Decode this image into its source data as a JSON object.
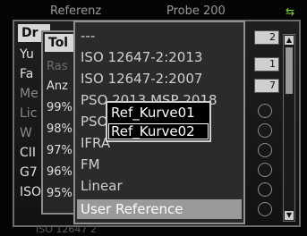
{
  "tabs": {
    "reference": "Referenz",
    "probe": "Probe 200",
    "icon": "swap-arrows-icon"
  },
  "background": {
    "selected_label": "Dr",
    "rows": [
      "Yu",
      "Fa",
      "Me",
      "Lic",
      "W",
      "CII",
      "G7",
      "ISO"
    ],
    "mini_values": [
      "2",
      "1",
      "7"
    ]
  },
  "tolerance": {
    "header": "Tol",
    "rows": [
      "Ras",
      "Anz",
      "99%",
      "98%",
      "97%",
      "96%",
      "95%"
    ]
  },
  "dropdown": {
    "items": [
      "---",
      "ISO 12647-2:2013",
      "ISO 12647-2:2007",
      "PSO 2013 MSP 2018",
      "PSO",
      "IFRA",
      "FM",
      "Linear",
      "User Reference"
    ],
    "selected_index": 8
  },
  "popup": {
    "items": [
      "Ref_Kurve01",
      "Ref_Kurve02"
    ],
    "highlighted_index": 1
  },
  "bottom": {
    "ghost_text": "ISO 12647 2"
  }
}
